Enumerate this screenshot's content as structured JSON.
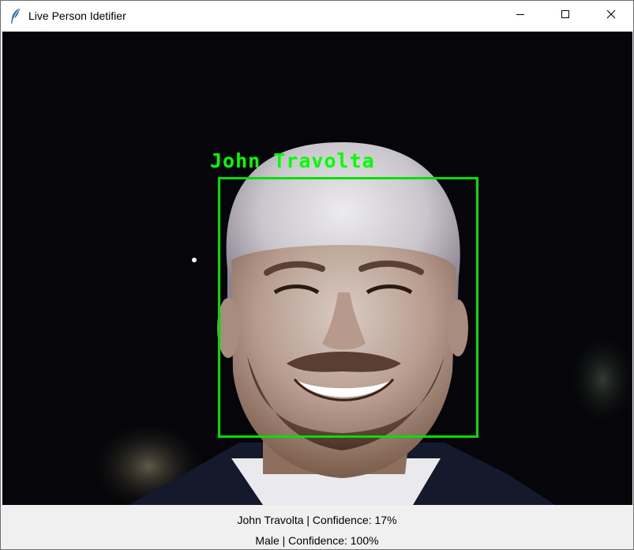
{
  "window": {
    "title": "Live Person Idetifier",
    "icon": "feather-icon",
    "controls": [
      "minimize-icon",
      "maximize-icon",
      "close-icon"
    ]
  },
  "video": {
    "face_label": "John Travolta",
    "box_color": "#00ff00"
  },
  "status": {
    "identity_line": "John Travolta | Confidence: 17%",
    "gender_line": "Male | Confidence: 100%"
  }
}
